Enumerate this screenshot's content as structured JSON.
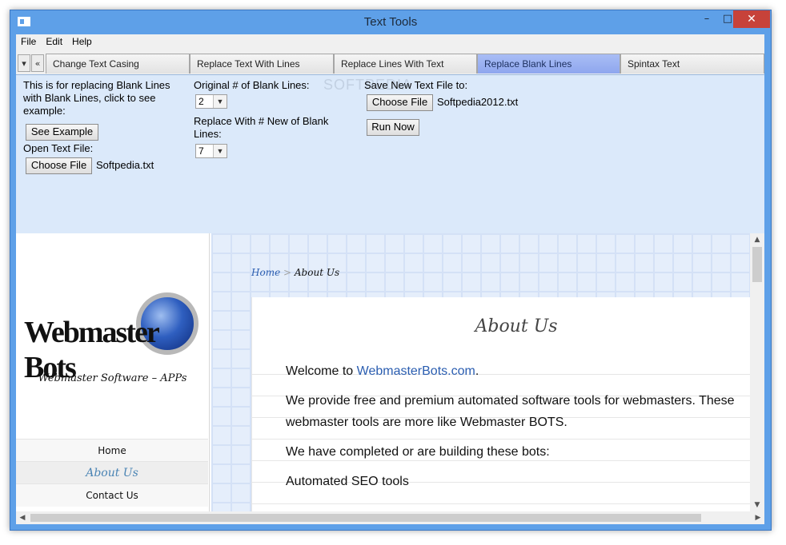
{
  "window": {
    "title": "Text Tools",
    "minimize": "–",
    "maximize": "□",
    "close": "✕"
  },
  "menu": [
    "File",
    "Edit",
    "Help"
  ],
  "tab_nav": {
    "down": "▾",
    "back": "«"
  },
  "tabs": [
    {
      "label": "Change Text Casing",
      "active": false
    },
    {
      "label": "Replace Text With Lines",
      "active": false
    },
    {
      "label": "Replace Lines With Text",
      "active": false
    },
    {
      "label": "Replace Blank Lines",
      "active": true
    },
    {
      "label": "Spintax Text",
      "active": false
    }
  ],
  "panel": {
    "description": "This is for replacing Blank Lines with Blank Lines, click to see example:",
    "see_example": "See Example",
    "open_label": "Open Text File:",
    "open_choose": "Choose File",
    "open_file": "Softpedia.txt",
    "orig_label": "Original # of Blank Lines:",
    "orig_value": "2",
    "replace_label": "Replace With # New of Blank Lines:",
    "replace_value": "7",
    "save_label": "Save New Text File to:",
    "save_choose": "Choose File",
    "save_file": "Softpedia2012.txt",
    "run_now": "Run Now",
    "watermark": "SOFTPEDIA"
  },
  "site": {
    "tagline": "Webmaster Software – APPs",
    "logo_text": "Webmaster Bots",
    "nav": [
      {
        "label": "Home",
        "active": false
      },
      {
        "label": "About Us",
        "active": true
      },
      {
        "label": "Contact Us",
        "active": false
      }
    ],
    "breadcrumb": {
      "home": "Home",
      "sep": ">",
      "current": "About Us"
    },
    "title": "About Us",
    "welcome_prefix": "Welcome to ",
    "welcome_link": "WebmasterBots.com",
    "welcome_suffix": ".",
    "para1_line1": "We provide free and premium automated software tools for webmasters. These",
    "para1_line2": "webmaster tools are more like Webmaster BOTS.",
    "para2": "We have completed or are building these bots:",
    "para3": "Automated SEO tools"
  },
  "scroll": {
    "up": "▲",
    "down": "▼",
    "left": "◀",
    "right": "▶"
  }
}
